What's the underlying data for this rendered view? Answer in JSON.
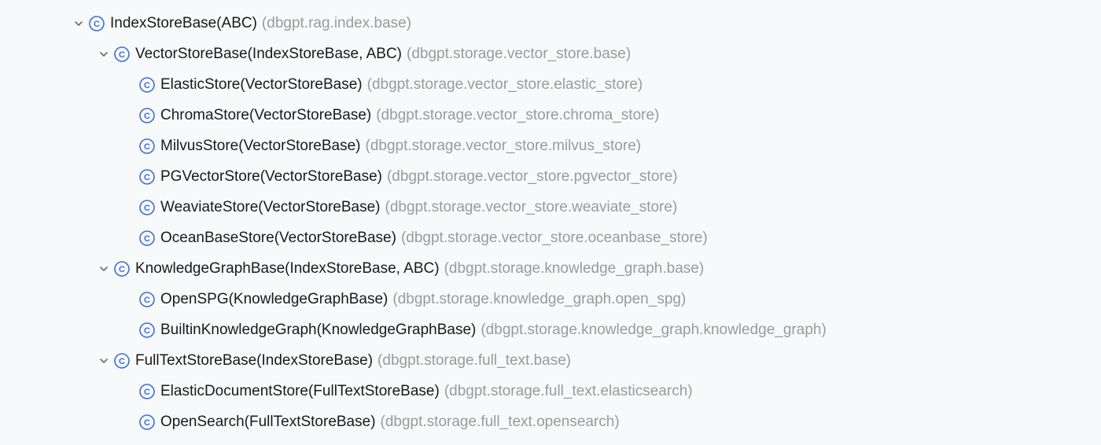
{
  "tree": [
    {
      "depth": 0,
      "expandable": true,
      "sig": "IndexStoreBase(ABC)",
      "module": "(dbgpt.rag.index.base)"
    },
    {
      "depth": 1,
      "expandable": true,
      "sig": "VectorStoreBase(IndexStoreBase, ABC)",
      "module": "(dbgpt.storage.vector_store.base)"
    },
    {
      "depth": 2,
      "expandable": false,
      "sig": "ElasticStore(VectorStoreBase)",
      "module": "(dbgpt.storage.vector_store.elastic_store)"
    },
    {
      "depth": 2,
      "expandable": false,
      "sig": "ChromaStore(VectorStoreBase)",
      "module": "(dbgpt.storage.vector_store.chroma_store)"
    },
    {
      "depth": 2,
      "expandable": false,
      "sig": "MilvusStore(VectorStoreBase)",
      "module": "(dbgpt.storage.vector_store.milvus_store)"
    },
    {
      "depth": 2,
      "expandable": false,
      "sig": "PGVectorStore(VectorStoreBase)",
      "module": "(dbgpt.storage.vector_store.pgvector_store)"
    },
    {
      "depth": 2,
      "expandable": false,
      "sig": "WeaviateStore(VectorStoreBase)",
      "module": "(dbgpt.storage.vector_store.weaviate_store)"
    },
    {
      "depth": 2,
      "expandable": false,
      "sig": "OceanBaseStore(VectorStoreBase)",
      "module": "(dbgpt.storage.vector_store.oceanbase_store)"
    },
    {
      "depth": 1,
      "expandable": true,
      "sig": "KnowledgeGraphBase(IndexStoreBase, ABC)",
      "module": "(dbgpt.storage.knowledge_graph.base)"
    },
    {
      "depth": 2,
      "expandable": false,
      "sig": "OpenSPG(KnowledgeGraphBase)",
      "module": "(dbgpt.storage.knowledge_graph.open_spg)"
    },
    {
      "depth": 2,
      "expandable": false,
      "sig": "BuiltinKnowledgeGraph(KnowledgeGraphBase)",
      "module": "(dbgpt.storage.knowledge_graph.knowledge_graph)"
    },
    {
      "depth": 1,
      "expandable": true,
      "sig": "FullTextStoreBase(IndexStoreBase)",
      "module": "(dbgpt.storage.full_text.base)"
    },
    {
      "depth": 2,
      "expandable": false,
      "sig": "ElasticDocumentStore(FullTextStoreBase)",
      "module": "(dbgpt.storage.full_text.elasticsearch)"
    },
    {
      "depth": 2,
      "expandable": false,
      "sig": "OpenSearch(FullTextStoreBase)",
      "module": "(dbgpt.storage.full_text.opensearch)"
    }
  ]
}
